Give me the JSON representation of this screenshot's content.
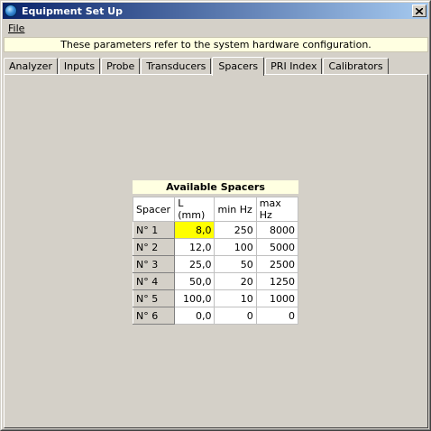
{
  "window": {
    "title": "Equipment Set Up",
    "close_glyph": "✕"
  },
  "menu": {
    "file": "File"
  },
  "info_text": "These parameters refer to the system hardware configuration.",
  "tabs": [
    "Analyzer",
    "Inputs",
    "Probe",
    "Transducers",
    "Spacers",
    "PRI Index",
    "Calibrators"
  ],
  "active_tab": "Spacers",
  "spacers": {
    "title": "Available Spacers",
    "columns": [
      "Spacer",
      "L (mm)",
      "min Hz",
      "max Hz"
    ],
    "rows": [
      [
        "N° 1",
        "8,0",
        "250",
        "8000"
      ],
      [
        "N° 2",
        "12,0",
        "100",
        "5000"
      ],
      [
        "N° 3",
        "25,0",
        "50",
        "2500"
      ],
      [
        "N° 4",
        "50,0",
        "20",
        "1250"
      ],
      [
        "N° 5",
        "100,0",
        "10",
        "1000"
      ],
      [
        "N° 6",
        "0,0",
        "0",
        "0"
      ]
    ],
    "highlight_color": "#ffff00"
  }
}
